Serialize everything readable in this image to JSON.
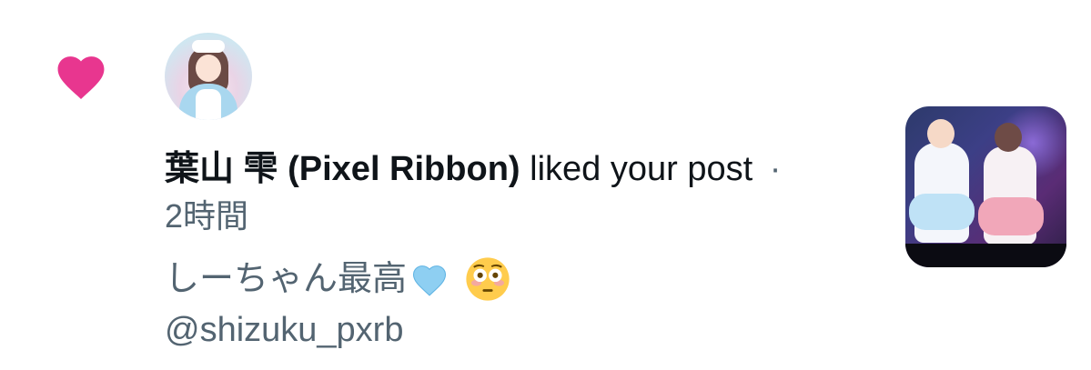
{
  "notification": {
    "type_icon": "heart-icon",
    "actor": {
      "display_name": "葉山 雫 (Pixel Ribbon)",
      "username": "@shizuku_pxrb",
      "avatar": "profile-photo"
    },
    "action": "liked your post",
    "separator": "·",
    "time": "2時間",
    "post_snippet": {
      "text": "しーちゃん最高",
      "emoji": [
        "light-blue-heart-icon",
        "flushed-face-icon"
      ]
    },
    "thumbnail": "post-media-thumbnail"
  },
  "colors": {
    "like_heart": "#E8368F",
    "primary_text": "#0F1419",
    "secondary_text": "#536471",
    "light_blue_heart": "#8ECFF2",
    "emoji_face": "#FFCC4D"
  }
}
